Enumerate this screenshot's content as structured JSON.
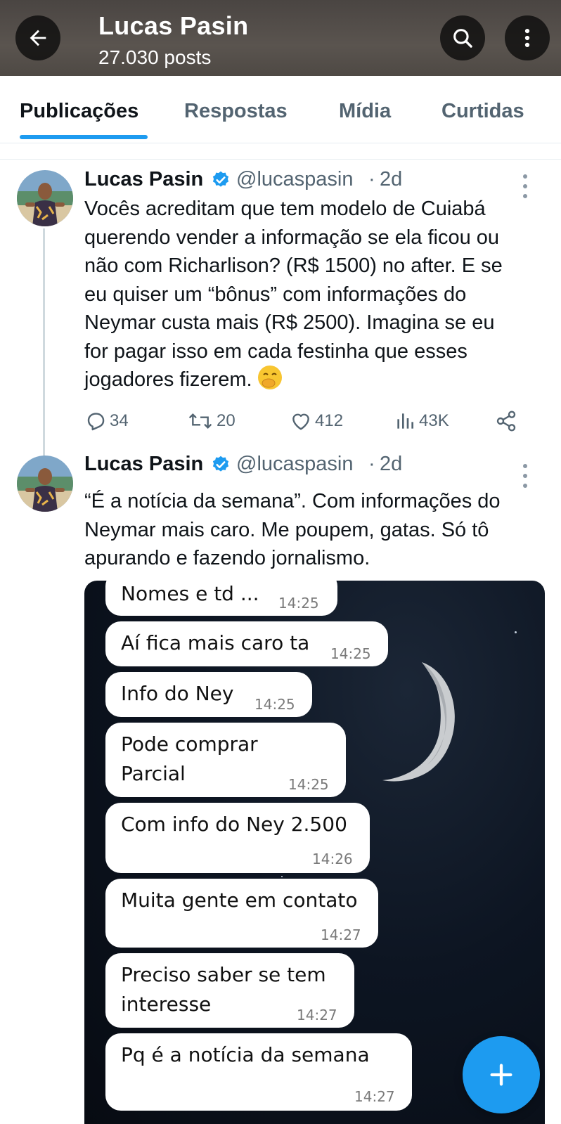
{
  "header": {
    "title": "Lucas Pasin",
    "subtitle": "27.030 posts"
  },
  "tabs": [
    {
      "label": "Publicações",
      "active": true
    },
    {
      "label": "Respostas",
      "active": false
    },
    {
      "label": "Mídia",
      "active": false
    },
    {
      "label": "Curtidas",
      "active": false
    }
  ],
  "colors": {
    "accent": "#1d9bf0",
    "secondary_text": "#536471"
  },
  "posts": [
    {
      "author": "Lucas Pasin",
      "verified": true,
      "handle": "@lucaspasin",
      "dot": "·",
      "time": "2d",
      "text_lines": [
        "Vocês acreditam que tem modelo de Cuiabá",
        "querendo vender a informação se ela ficou ou",
        "não com Richarlison? (R$ 1500) no after. E se",
        "eu quiser um “bônus” com informações do",
        "Neymar custa mais (R$ 2500). Imagina se eu",
        "for pagar isso em cada festinha que esses",
        "jogadores fizerem."
      ],
      "emoji": "hand-over-mouth-face",
      "stats": {
        "replies": "34",
        "reposts": "20",
        "likes": "412",
        "views": "43K"
      }
    },
    {
      "author": "Lucas Pasin",
      "verified": true,
      "handle": "@lucaspasin",
      "dot": "·",
      "time": "2d",
      "text_lines": [
        "“É a notícia da semana”. Com informações do",
        "Neymar mais caro. Me poupem, gatas. Só tô",
        "apurando e fazendo jornalismo."
      ],
      "media_chat": [
        {
          "lines": [
            "Nomes e td ..."
          ],
          "time": "14:25"
        },
        {
          "lines": [
            "Aí fica mais caro ta"
          ],
          "time": "14:25"
        },
        {
          "lines": [
            "Info do Ney"
          ],
          "time": "14:25"
        },
        {
          "lines": [
            "Pode comprar",
            "Parcial"
          ],
          "time": "14:25"
        },
        {
          "lines": [
            "Com info do Ney 2.500"
          ],
          "time": "14:26"
        },
        {
          "lines": [
            "Muita gente em contato"
          ],
          "time": "14:27"
        },
        {
          "lines": [
            "Preciso saber se tem",
            "interesse"
          ],
          "time": "14:27"
        },
        {
          "lines": [
            "Pq é a notícia da semana"
          ],
          "time": "14:27"
        }
      ]
    }
  ],
  "icons": {
    "back": "arrow-left-icon",
    "search": "search-icon",
    "more": "more-vertical-icon",
    "reply": "reply-icon",
    "repost": "repost-icon",
    "like": "heart-icon",
    "views": "views-icon",
    "share": "share-icon",
    "compose": "plus-icon"
  }
}
